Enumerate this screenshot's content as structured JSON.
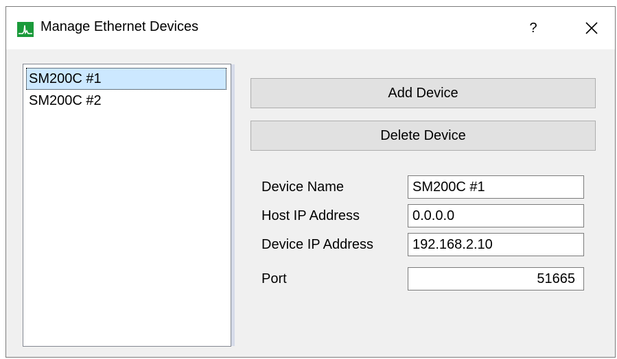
{
  "window": {
    "title": "Manage Ethernet Devices",
    "help_label": "?",
    "accent_color": "#1a9a3a"
  },
  "device_list": {
    "items": [
      {
        "label": "SM200C #1",
        "selected": true
      },
      {
        "label": "SM200C #2",
        "selected": false
      }
    ]
  },
  "actions": {
    "add_label": "Add Device",
    "delete_label": "Delete Device"
  },
  "fields": {
    "device_name": {
      "label": "Device Name",
      "value": "SM200C #1"
    },
    "host_ip": {
      "label": "Host IP Address",
      "value": "0.0.0.0"
    },
    "device_ip": {
      "label": "Device IP Address",
      "value": "192.168.2.10"
    },
    "port": {
      "label": "Port",
      "value": "51665"
    }
  },
  "icons": {
    "app": "spectrum-app-icon",
    "close": "close-icon"
  }
}
